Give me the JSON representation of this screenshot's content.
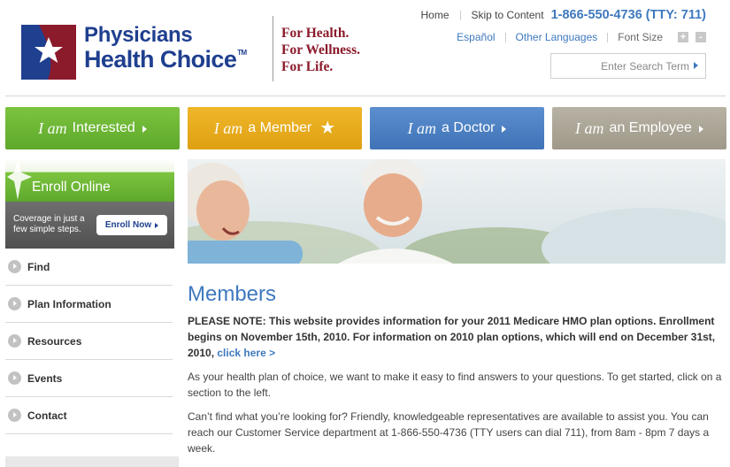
{
  "logo": {
    "line1": "Physicians",
    "line2": "Health Choice",
    "mark": "TM"
  },
  "tagline": [
    "For Health.",
    "For Wellness.",
    "For Life."
  ],
  "toplinks": {
    "home": "Home",
    "skip": "Skip to Content",
    "phone": "1-866-550-4736 (TTY: 711)"
  },
  "sublinks": {
    "espanol": "Español",
    "other_languages": "Other Languages",
    "font_size": "Font Size",
    "font_plus": "+",
    "font_minus": "-"
  },
  "search": {
    "placeholder": "Enter Search Term"
  },
  "nav": [
    {
      "iam": "I am",
      "label": "Interested"
    },
    {
      "iam": "I am",
      "label": "a Member"
    },
    {
      "iam": "I am",
      "label": "a Doctor"
    },
    {
      "iam": "I am",
      "label": "an Employee"
    }
  ],
  "enroll": {
    "title": "Enroll Online",
    "text": "Coverage in just a few simple steps.",
    "button": "Enroll Now"
  },
  "sidebar": [
    "Find",
    "Plan Information",
    "Resources",
    "Events",
    "Contact"
  ],
  "content": {
    "heading": "Members",
    "note": "PLEASE NOTE: This website provides information for your 2011 Medicare HMO plan options. Enrollment begins on November 15th, 2010. For information on 2010 plan options, which will end on December 31st, 2010,",
    "note_link": "click here >",
    "para1": "As your health plan of choice, we want to make it easy to find answers to your questions. To get started, click on a section to the left.",
    "para2": "Can’t find what you’re looking for? Friendly, knowledgeable representatives are available to assist you. You can reach our Customer Service department at 1-866-550-4736 (TTY users can dial 711), from 8am - 8pm 7 days a week."
  },
  "colors": {
    "brand_blue": "#1f3f8f",
    "brand_red": "#8b1a2b",
    "link_blue": "#3f79bf",
    "tab_green": "#6cb535",
    "tab_gold": "#e8ab1d",
    "tab_blue": "#4d81c3",
    "tab_gray": "#aca697"
  }
}
